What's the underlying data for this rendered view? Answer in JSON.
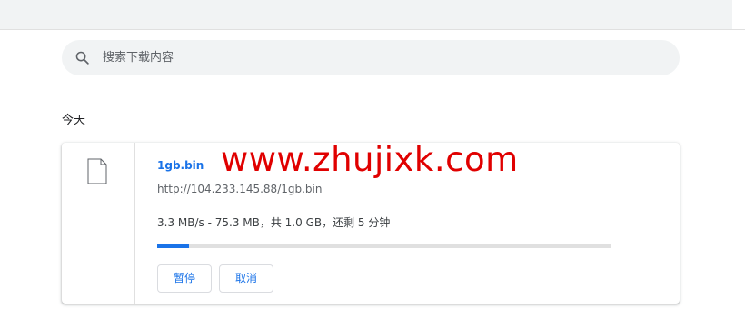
{
  "search": {
    "placeholder": "搜索下载内容",
    "icon": "search-icon"
  },
  "section": {
    "label": "今天"
  },
  "download": {
    "file_name": "1gb.bin",
    "url": "http://104.233.145.88/1gb.bin",
    "status": "3.3 MB/s - 75.3 MB，共 1.0 GB，还剩 5 分钟",
    "progress_fraction": 0.07,
    "pause_label": "暂停",
    "cancel_label": "取消",
    "icon": "file-icon"
  },
  "watermark": {
    "text": "www.zhujixk.com",
    "color": "#e00000"
  },
  "colors": {
    "accent": "#1a73e8",
    "progress_track": "#e0e0e0"
  }
}
